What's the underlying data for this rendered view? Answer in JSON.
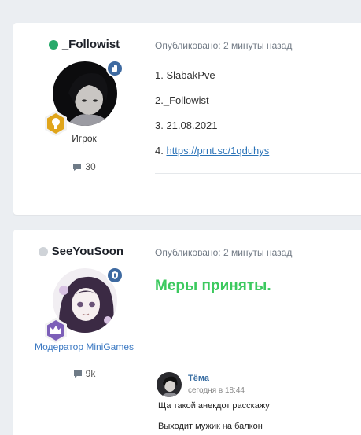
{
  "posts": [
    {
      "author": "_Followist",
      "status_color": "#27a96a",
      "role": "Игрок",
      "role_color": "#333333",
      "replies": "30",
      "meta": "Опубликовано: 2 минуты назад",
      "lines": [
        "1. SlabakPve",
        "2._Followist",
        "3. 21.08.2021"
      ],
      "link_prefix": "4. ",
      "link": "https://prnt.sc/1qduhys"
    },
    {
      "author": "SeeYouSoon_",
      "status_color": "#cfd3d8",
      "role": "Модератор MiniGames",
      "role_color": "#3a78c2",
      "replies": "9k",
      "meta": "Опубликовано: 2 минуты назад",
      "headline": "Меры приняты.",
      "headline_color": "#3bc95e",
      "quote": {
        "name": "Тёма",
        "time": "сегодня в 18:44",
        "lines": [
          "Ща такой анекдот расскажу",
          "Выходит мужик на балкон"
        ]
      }
    }
  ],
  "icons": {
    "reply": "comment-icon",
    "badge1": "hand-icon",
    "badge1_bottom": "lightbulb-icon",
    "badge2": "shield-icon",
    "badge2_bottom": "crown-icon"
  }
}
